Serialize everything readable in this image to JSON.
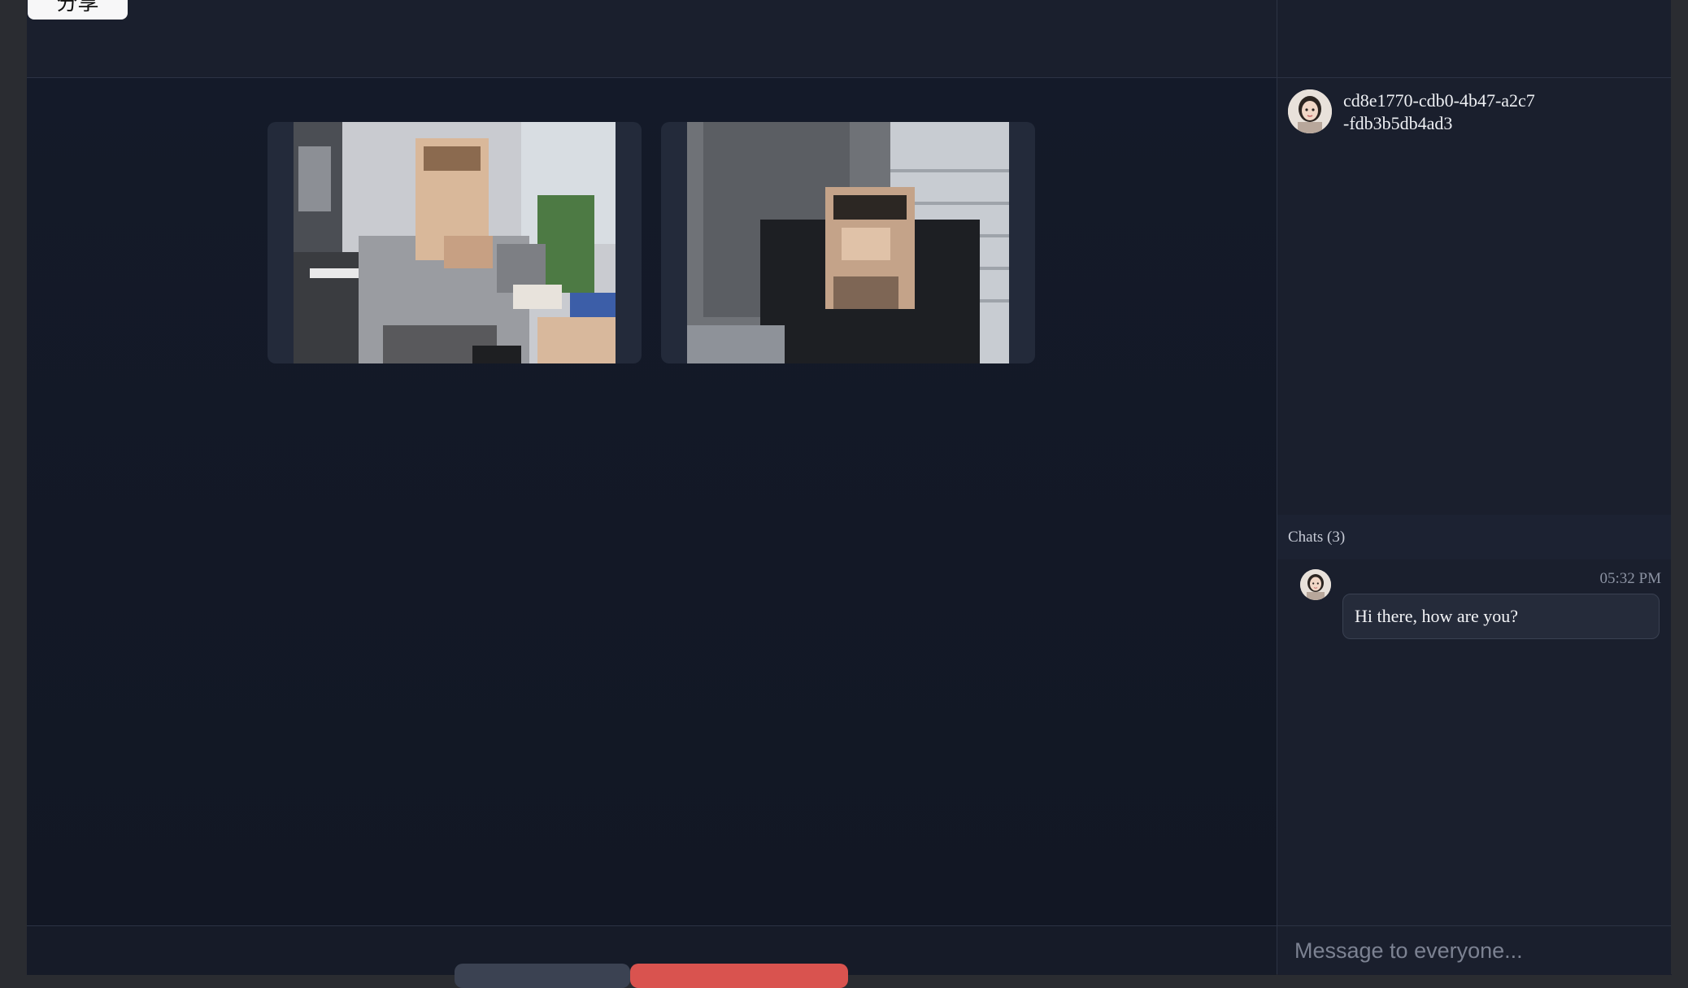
{
  "toolbar": {
    "share_label": "分享"
  },
  "stage": {
    "tiles": [
      {
        "name": "video-tile-1",
        "video": "participant-video-feed"
      },
      {
        "name": "video-tile-2",
        "video": "participant-video-feed"
      }
    ]
  },
  "panel": {
    "participant": {
      "id": "cd8e1770-cdb0-4b47-a2c7-fdb3b5db4ad3",
      "avatar": "avatar-icon"
    },
    "chats_label": "Chats (3)",
    "messages": [
      {
        "time": "05:32 PM",
        "text": "Hi there, how are you?",
        "avatar": "avatar-icon"
      }
    ],
    "composer": {
      "placeholder": "Message to everyone..."
    }
  },
  "colors": {
    "danger": "#d9534f",
    "background": "#141a28",
    "panel": "#1a1f2d"
  }
}
